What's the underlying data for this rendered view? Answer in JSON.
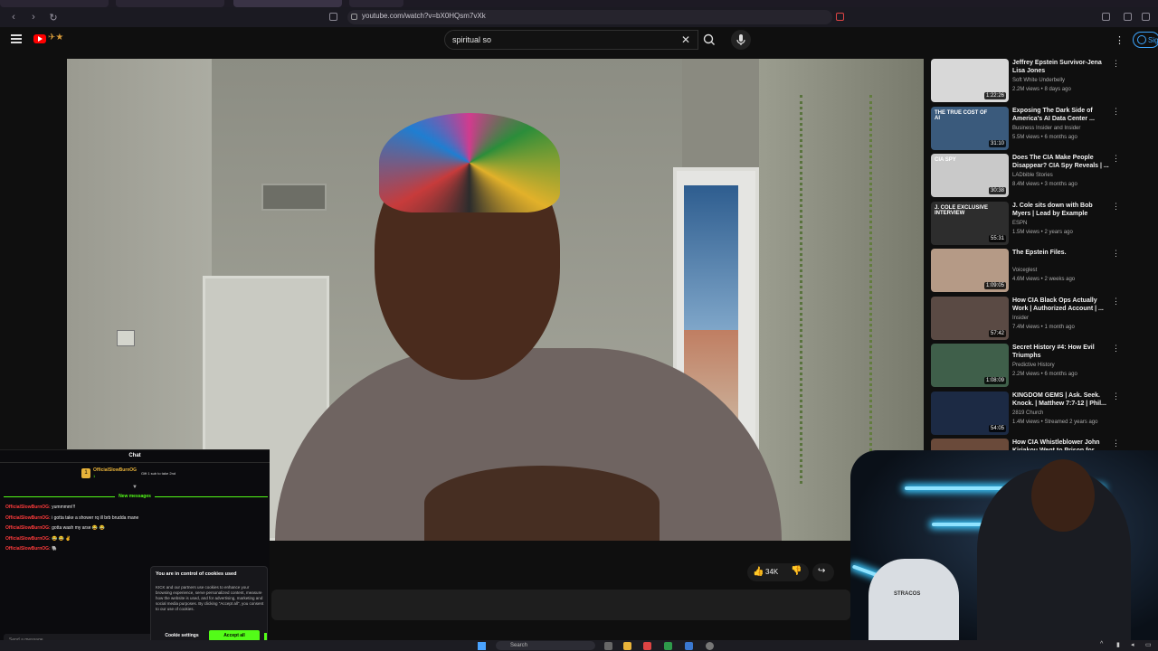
{
  "browser": {
    "url": "youtube.com/watch?v=bX0HQsm7vXk"
  },
  "header": {
    "search_value": "spiritual so",
    "signin_label": "Sig"
  },
  "player": {
    "likes": "34K"
  },
  "sidebar": {
    "videos": [
      {
        "title": "Jeffrey Epstein Survivor-Jena Lisa Jones",
        "channel": "Soft White Underbelly",
        "meta": "2.2M views • 8 days ago",
        "duration": "1:22:26",
        "thumb_color": "#d8d8d8"
      },
      {
        "title": "Exposing The Dark Side of America's AI Data Center ...",
        "channel": "Business Insider  and Insider",
        "meta": "5.5M views • 6 months ago",
        "duration": "31:10",
        "thumb_color": "#3a5a7c",
        "thumb_label": "THE TRUE COST OF AI"
      },
      {
        "title": "Does The CIA Make People Disappear? CIA Spy Reveals | ...",
        "channel": "LADbible Stories",
        "meta": "8.4M views • 3 months ago",
        "duration": "30:38",
        "thumb_color": "#c9c9c9",
        "thumb_label": "CIA SPY"
      },
      {
        "title": "J. Cole sits down with Bob Myers | Lead by Example",
        "channel": "ESPN",
        "meta": "1.5M views • 2 years ago",
        "duration": "55:31",
        "thumb_color": "#2d2d2d",
        "thumb_label": "J. COLE EXCLUSIVE INTERVIEW"
      },
      {
        "title": "The Epstein Files.",
        "channel": "Voiceglest",
        "meta": "4.6M views • 2 weeks ago",
        "duration": "1:09:05",
        "thumb_color": "#b59a86"
      },
      {
        "title": "How CIA Black Ops Actually Work | Authorized Account | ...",
        "channel": "Insider",
        "meta": "7.4M views • 1 month ago",
        "duration": "57:42",
        "thumb_color": "#5a4a44"
      },
      {
        "title": "Secret History #4: How Evil Triumphs",
        "channel": "Predictive History",
        "meta": "2.2M views • 6 months ago",
        "duration": "1:08:09",
        "thumb_color": "#3f5f4a"
      },
      {
        "title": "KINGDOM GEMS | Ask. Seek. Knock. | Matthew 7:7-12 | Phil...",
        "channel": "2819 Church",
        "meta": "1.4M views • Streamed 2 years ago",
        "duration": "54:05",
        "thumb_color": "#1c2a44"
      },
      {
        "title": "How CIA Whistleblower John Kiriakou Went to Prison for ...",
        "channel": "",
        "meta": "",
        "duration": "",
        "thumb_color": "#6a4a3a"
      }
    ]
  },
  "chat": {
    "title": "Chat",
    "pinned_user": "OfficialSlowBurnOG",
    "pinned_sub": "1",
    "pinned_gift": "Gift 1 sub to take 2nd",
    "new_messages_label": "New messages",
    "messages": [
      {
        "user": "OfficialSlowBurnOG:",
        "text": "yummmm!!!"
      },
      {
        "user": "OfficialSlowBurnOG:",
        "text": "i gotta take a shower rq ill brb brudda mane"
      },
      {
        "user": "OfficialSlowBurnOG:",
        "text": "gotta wash my arse 😂 😂"
      },
      {
        "user": "OfficialSlowBurnOG:",
        "text": "😂 😂 ✌"
      },
      {
        "user": "OfficialSlowBurnOG:",
        "text": "🐘"
      }
    ],
    "input_placeholder": "Send a message"
  },
  "cookie": {
    "title": "You are in control of cookies used",
    "body": "KICK and our partners use cookies to enhance your browsing experience, serve personalized content, measure how the website is used, and for advertising, marketing and social media purposes. By clicking \"Accept all\", you consent to our use of cookies.",
    "settings_label": "Cookie settings",
    "accept_label": "Accept all"
  },
  "webcam": {
    "chair_text": "STRACOS"
  },
  "taskbar": {
    "search_placeholder": "Search"
  }
}
